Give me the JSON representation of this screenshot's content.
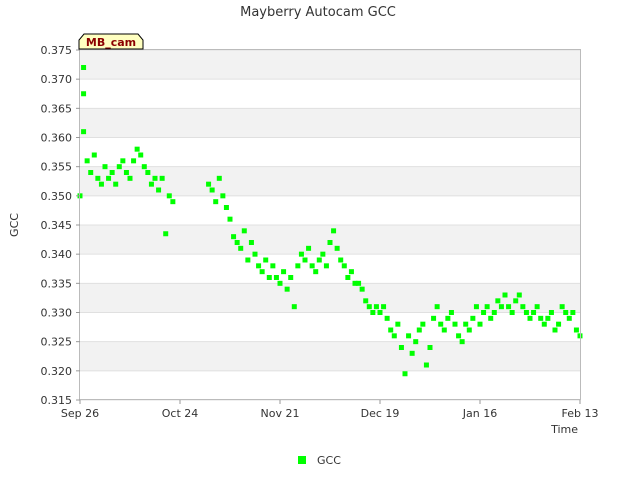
{
  "chart_data": {
    "type": "scatter",
    "title": "Mayberry Autocam GCC",
    "xlabel": "Time",
    "ylabel": "GCC",
    "tag": "MB_cam",
    "x_tick_labels": [
      "Sep 26",
      "Oct 24",
      "Nov 21",
      "Dec 19",
      "Jan 16",
      "Feb 13"
    ],
    "x_range": [
      "Sep 26",
      "Feb 13"
    ],
    "ylim": [
      0.315,
      0.375
    ],
    "y_ticks": [
      "0.315",
      "0.320",
      "0.325",
      "0.330",
      "0.335",
      "0.340",
      "0.345",
      "0.350",
      "0.355",
      "0.360",
      "0.365",
      "0.370",
      "0.375"
    ],
    "grid": "alternating horizontal bands",
    "legend_position": "bottom-center",
    "series": [
      {
        "name": "GCC",
        "color": "#00ff00",
        "marker": "square",
        "points": [
          [
            "Sep 26",
            0.35
          ],
          [
            "Sep 27",
            0.3675
          ],
          [
            "Sep 27",
            0.372
          ],
          [
            "Sep 27",
            0.361
          ],
          [
            "Sep 28",
            0.356
          ],
          [
            "Sep 29",
            0.354
          ],
          [
            "Sep 30",
            0.357
          ],
          [
            "Oct 01",
            0.353
          ],
          [
            "Oct 02",
            0.352
          ],
          [
            "Oct 03",
            0.355
          ],
          [
            "Oct 04",
            0.353
          ],
          [
            "Oct 05",
            0.354
          ],
          [
            "Oct 06",
            0.352
          ],
          [
            "Oct 07",
            0.355
          ],
          [
            "Oct 08",
            0.356
          ],
          [
            "Oct 09",
            0.354
          ],
          [
            "Oct 10",
            0.353
          ],
          [
            "Oct 11",
            0.356
          ],
          [
            "Oct 12",
            0.358
          ],
          [
            "Oct 13",
            0.357
          ],
          [
            "Oct 14",
            0.355
          ],
          [
            "Oct 15",
            0.354
          ],
          [
            "Oct 16",
            0.352
          ],
          [
            "Oct 17",
            0.353
          ],
          [
            "Oct 18",
            0.351
          ],
          [
            "Oct 19",
            0.353
          ],
          [
            "Oct 20",
            0.3435
          ],
          [
            "Oct 21",
            0.35
          ],
          [
            "Oct 22",
            0.349
          ],
          [
            "Nov 01",
            0.352
          ],
          [
            "Nov 02",
            0.351
          ],
          [
            "Nov 03",
            0.349
          ],
          [
            "Nov 04",
            0.353
          ],
          [
            "Nov 05",
            0.35
          ],
          [
            "Nov 06",
            0.348
          ],
          [
            "Nov 07",
            0.346
          ],
          [
            "Nov 08",
            0.343
          ],
          [
            "Nov 09",
            0.342
          ],
          [
            "Nov 10",
            0.341
          ],
          [
            "Nov 11",
            0.344
          ],
          [
            "Nov 12",
            0.339
          ],
          [
            "Nov 13",
            0.342
          ],
          [
            "Nov 14",
            0.34
          ],
          [
            "Nov 15",
            0.338
          ],
          [
            "Nov 16",
            0.337
          ],
          [
            "Nov 17",
            0.339
          ],
          [
            "Nov 18",
            0.336
          ],
          [
            "Nov 19",
            0.338
          ],
          [
            "Nov 20",
            0.336
          ],
          [
            "Nov 21",
            0.335
          ],
          [
            "Nov 22",
            0.337
          ],
          [
            "Nov 23",
            0.334
          ],
          [
            "Nov 24",
            0.336
          ],
          [
            "Nov 25",
            0.331
          ],
          [
            "Nov 26",
            0.338
          ],
          [
            "Nov 27",
            0.34
          ],
          [
            "Nov 28",
            0.339
          ],
          [
            "Nov 29",
            0.341
          ],
          [
            "Nov 30",
            0.338
          ],
          [
            "Dec 01",
            0.337
          ],
          [
            "Dec 02",
            0.339
          ],
          [
            "Dec 03",
            0.34
          ],
          [
            "Dec 04",
            0.338
          ],
          [
            "Dec 05",
            0.342
          ],
          [
            "Dec 06",
            0.344
          ],
          [
            "Dec 07",
            0.341
          ],
          [
            "Dec 08",
            0.339
          ],
          [
            "Dec 09",
            0.338
          ],
          [
            "Dec 10",
            0.336
          ],
          [
            "Dec 11",
            0.337
          ],
          [
            "Dec 12",
            0.335
          ],
          [
            "Dec 13",
            0.335
          ],
          [
            "Dec 14",
            0.334
          ],
          [
            "Dec 15",
            0.332
          ],
          [
            "Dec 16",
            0.331
          ],
          [
            "Dec 17",
            0.33
          ],
          [
            "Dec 18",
            0.331
          ],
          [
            "Dec 19",
            0.33
          ],
          [
            "Dec 20",
            0.331
          ],
          [
            "Dec 21",
            0.329
          ],
          [
            "Dec 22",
            0.327
          ],
          [
            "Dec 23",
            0.326
          ],
          [
            "Dec 24",
            0.328
          ],
          [
            "Dec 25",
            0.324
          ],
          [
            "Dec 26",
            0.3195
          ],
          [
            "Dec 27",
            0.326
          ],
          [
            "Dec 28",
            0.323
          ],
          [
            "Dec 29",
            0.325
          ],
          [
            "Dec 30",
            0.327
          ],
          [
            "Dec 31",
            0.328
          ],
          [
            "Jan 01",
            0.321
          ],
          [
            "Jan 02",
            0.324
          ],
          [
            "Jan 03",
            0.329
          ],
          [
            "Jan 04",
            0.331
          ],
          [
            "Jan 05",
            0.328
          ],
          [
            "Jan 06",
            0.327
          ],
          [
            "Jan 07",
            0.329
          ],
          [
            "Jan 08",
            0.33
          ],
          [
            "Jan 09",
            0.328
          ],
          [
            "Jan 10",
            0.326
          ],
          [
            "Jan 11",
            0.325
          ],
          [
            "Jan 12",
            0.328
          ],
          [
            "Jan 13",
            0.327
          ],
          [
            "Jan 14",
            0.329
          ],
          [
            "Jan 15",
            0.331
          ],
          [
            "Jan 16",
            0.328
          ],
          [
            "Jan 17",
            0.33
          ],
          [
            "Jan 18",
            0.331
          ],
          [
            "Jan 19",
            0.329
          ],
          [
            "Jan 20",
            0.33
          ],
          [
            "Jan 21",
            0.332
          ],
          [
            "Jan 22",
            0.331
          ],
          [
            "Jan 23",
            0.333
          ],
          [
            "Jan 24",
            0.331
          ],
          [
            "Jan 25",
            0.33
          ],
          [
            "Jan 26",
            0.332
          ],
          [
            "Jan 27",
            0.333
          ],
          [
            "Jan 28",
            0.331
          ],
          [
            "Jan 29",
            0.33
          ],
          [
            "Jan 30",
            0.329
          ],
          [
            "Jan 31",
            0.33
          ],
          [
            "Feb 01",
            0.331
          ],
          [
            "Feb 02",
            0.329
          ],
          [
            "Feb 03",
            0.328
          ],
          [
            "Feb 04",
            0.329
          ],
          [
            "Feb 05",
            0.33
          ],
          [
            "Feb 06",
            0.327
          ],
          [
            "Feb 07",
            0.328
          ],
          [
            "Feb 08",
            0.331
          ],
          [
            "Feb 09",
            0.33
          ],
          [
            "Feb 10",
            0.329
          ],
          [
            "Feb 11",
            0.33
          ],
          [
            "Feb 12",
            0.327
          ],
          [
            "Feb 13",
            0.326
          ]
        ]
      }
    ],
    "legend": [
      {
        "label": "GCC",
        "color": "#00ff00"
      }
    ]
  }
}
